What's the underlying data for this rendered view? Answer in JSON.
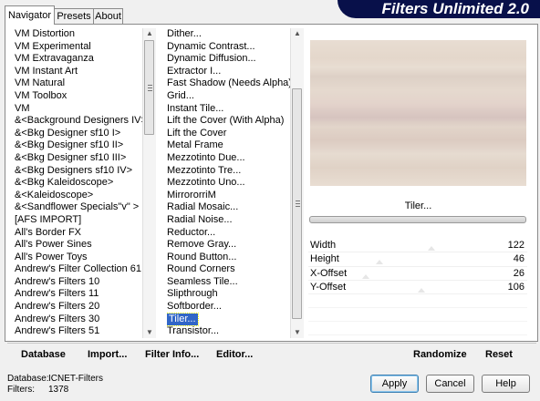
{
  "tabs": [
    {
      "label": "Navigator"
    },
    {
      "label": "Presets"
    },
    {
      "label": "About"
    }
  ],
  "banner": {
    "title": "Filters Unlimited 2.0"
  },
  "categories": [
    "VM Distortion",
    "VM Experimental",
    "VM Extravaganza",
    "VM Instant Art",
    "VM Natural",
    "VM Toolbox",
    "VM",
    "&<Background Designers IV>",
    "&<Bkg Designer sf10 I>",
    "&<Bkg Designer sf10 II>",
    "&<Bkg Designer sf10 III>",
    "&<Bkg Designers sf10 IV>",
    "&<Bkg Kaleidoscope>",
    "&<Kaleidoscope>",
    "&<Sandflower Specials\"v\" >",
    "[AFS IMPORT]",
    "All's Border FX",
    "All's Power Sines",
    "All's Power Toys",
    "Andrew's Filter Collection 61",
    "Andrew's Filters 10",
    "Andrew's Filters 11",
    "Andrew's Filters 20",
    "Andrew's Filters 30",
    "Andrew's Filters 51"
  ],
  "filters": [
    "Dither...",
    "Dynamic Contrast...",
    "Dynamic Diffusion...",
    "Extractor I...",
    "Fast Shadow (Needs Alpha)",
    "Grid...",
    "Instant Tile...",
    "Lift the Cover (With Alpha)",
    "Lift the Cover",
    "Metal Frame",
    "Mezzotinto Due...",
    "Mezzotinto Tre...",
    "Mezzotinto Uno...",
    "MirrororriM",
    "Radial Mosaic...",
    "Radial Noise...",
    "Reductor...",
    "Remove Gray...",
    "Round Button...",
    "Round Corners",
    "Seamless Tile...",
    "Slipthrough",
    "Softborder...",
    "Tiler...",
    "Transistor..."
  ],
  "selected_filter_index": 23,
  "current_filter": "Tiler...",
  "params": [
    {
      "label": "Width",
      "value": "122",
      "level": 0.48
    },
    {
      "label": "Height",
      "value": "46",
      "level": 0.18
    },
    {
      "label": "X-Offset",
      "value": "26",
      "level": 0.1
    },
    {
      "label": "Y-Offset",
      "value": "106",
      "level": 0.42
    }
  ],
  "toolbar": {
    "database": "Database",
    "import": "Import...",
    "filter_info": "Filter Info...",
    "editor": "Editor...",
    "randomize": "Randomize",
    "reset": "Reset"
  },
  "buttons": {
    "apply": "Apply",
    "cancel": "Cancel",
    "help": "Help"
  },
  "status": {
    "database_label": "Database:",
    "database_value": "ICNET-Filters",
    "filters_label": "Filters:",
    "filters_value": "1378"
  },
  "colors": {
    "banner_bg": "#08104a",
    "selection": "#3166c7"
  }
}
